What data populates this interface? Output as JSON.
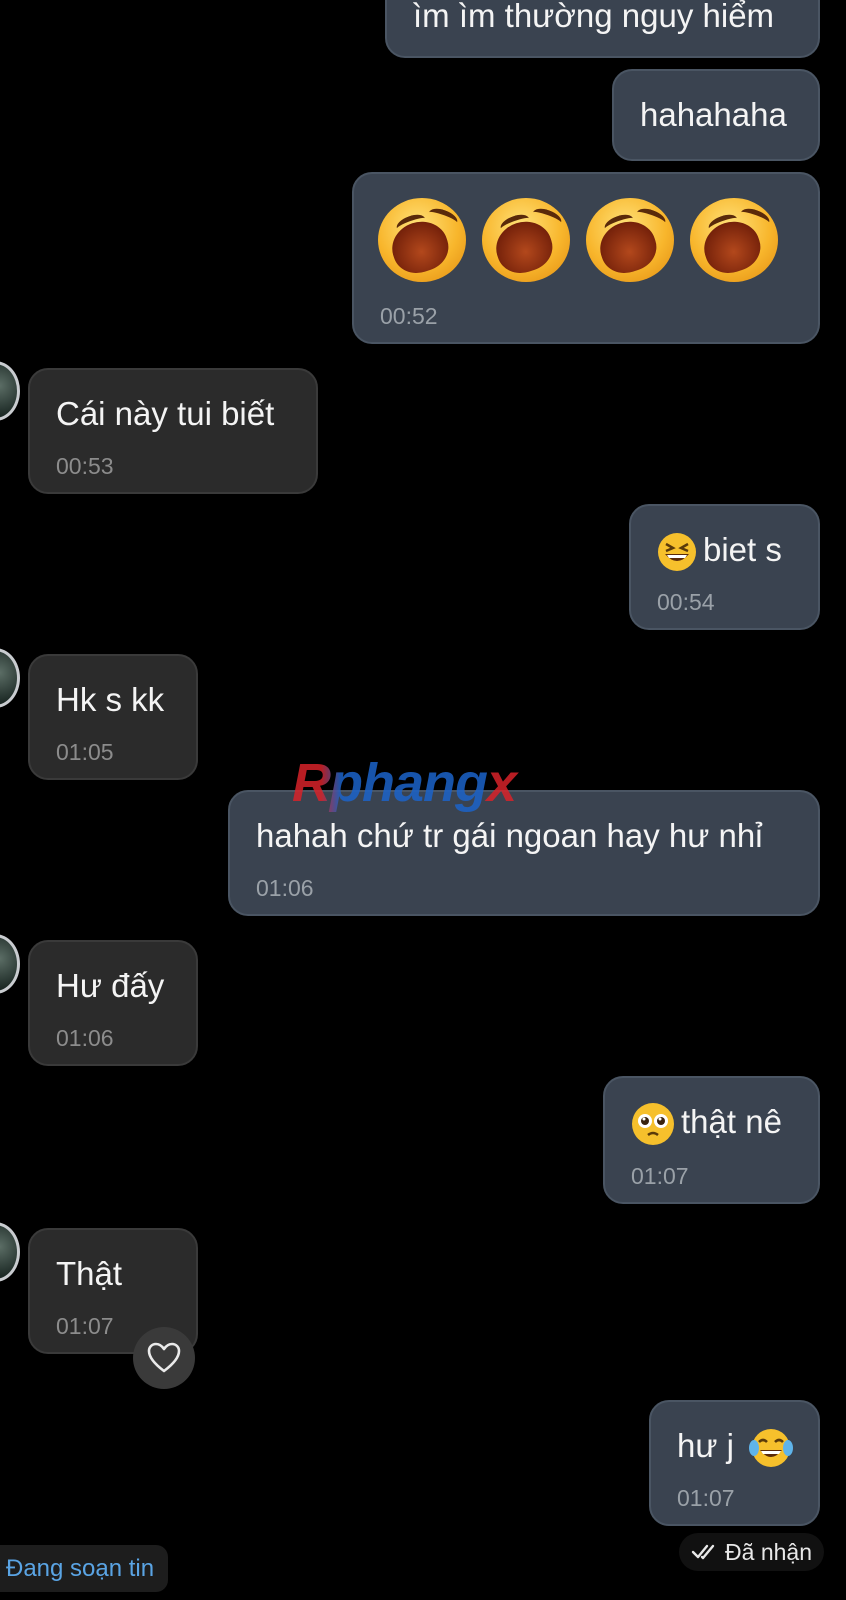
{
  "messages": [
    {
      "text": "ìm ìm thường nguy hiểm",
      "time": ""
    },
    {
      "text": "hahahaha",
      "time": ""
    },
    {
      "text": "",
      "time": "00:52",
      "emojis": [
        "laughing-face",
        "laughing-face",
        "laughing-face",
        "laughing-face"
      ]
    },
    {
      "text": "Cái này tui biết",
      "time": "00:53"
    },
    {
      "text": "biet s",
      "time": "00:54"
    },
    {
      "text": "Hk s kk",
      "time": "01:05"
    },
    {
      "text": "hahah chứ tr gái ngoan hay hư nhỉ",
      "time": "01:06"
    },
    {
      "text": "Hư đấy",
      "time": "01:06"
    },
    {
      "text": "thật nê",
      "time": "01:07"
    },
    {
      "text": "Thật",
      "time": "01:07"
    },
    {
      "text": "hư j",
      "time": "01:07"
    }
  ],
  "watermark": {
    "part1": "Rphang",
    "part2": "x"
  },
  "status": {
    "label": "Đã nhận"
  },
  "typing": {
    "label": "Đang soạn tin"
  },
  "colors": {
    "background": "#000000",
    "outgoing_bubble": "#3a4350",
    "incoming_bubble": "#2b2b2b",
    "typing_text": "#5aa4e4"
  },
  "icons": [
    "double-check-icon",
    "heart-icon",
    "grinning-squinting-emoji",
    "pleading-face-emoji",
    "tears-of-joy-emoji",
    "laughing-face-emoji"
  ]
}
